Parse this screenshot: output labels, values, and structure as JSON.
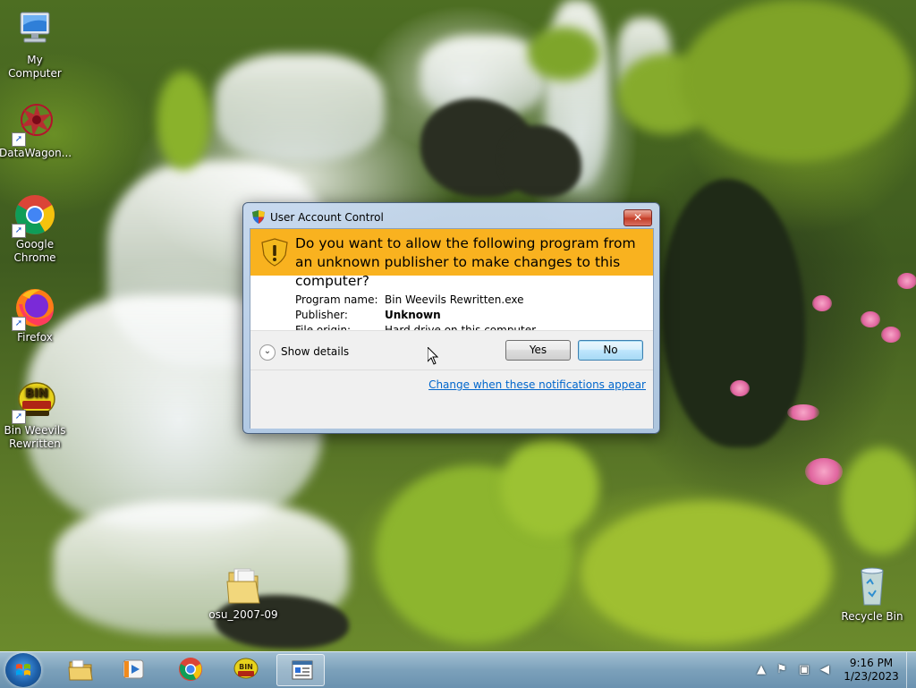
{
  "desktop": {
    "icons": [
      {
        "label": "My Computer"
      },
      {
        "label": "DataWagon..."
      },
      {
        "label": "Google Chrome"
      },
      {
        "label": "Firefox"
      },
      {
        "label": "Bin Weevils Rewritten"
      },
      {
        "label": "osu_2007-09"
      },
      {
        "label": "Recycle Bin"
      }
    ]
  },
  "uac": {
    "title": "User Account Control",
    "close_label": "✕",
    "question": "Do you want to allow the following program from an unknown publisher to make changes to this computer?",
    "program_name_label": "Program name:",
    "program_name_value": "Bin Weevils Rewritten.exe",
    "publisher_label": "Publisher:",
    "publisher_value": "Unknown",
    "file_origin_label": "File origin:",
    "file_origin_value": "Hard drive on this computer",
    "show_details_label": "Show details",
    "yes_label": "Yes",
    "no_label": "No",
    "change_link": "Change when these notifications appear"
  },
  "taskbar": {
    "items": [
      {
        "icon": "windows-explorer-icon"
      },
      {
        "icon": "media-player-icon"
      },
      {
        "icon": "chrome-icon"
      },
      {
        "icon": "bin-weevils-icon"
      },
      {
        "icon": "uac-window-icon",
        "active": true
      }
    ],
    "clock_time": "9:16 PM",
    "clock_date": "1/23/2023"
  },
  "colors": {
    "uac_banner": "#f9b21f",
    "link": "#0066cc",
    "shield": "#e8a20c"
  }
}
